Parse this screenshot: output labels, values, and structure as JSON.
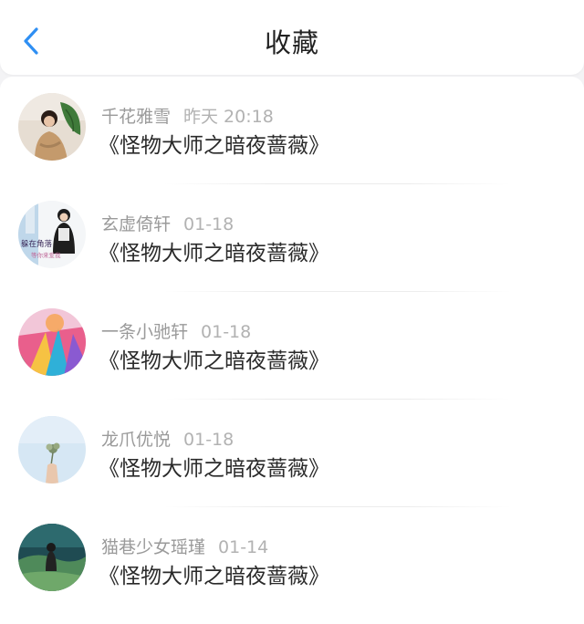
{
  "header": {
    "title": "收藏",
    "back_icon": "chevron-left-icon",
    "accent_color": "#2f8ff3"
  },
  "favorites": [
    {
      "username": "千花雅雪",
      "time": "昨天 20:18",
      "title": "《怪物大师之暗夜蔷薇》",
      "avatar_icon": "avatar-girl-with-leaf"
    },
    {
      "username": "玄虚倚轩",
      "time": "01-18",
      "title": "《怪物大师之暗夜蔷薇》",
      "avatar_icon": "avatar-girl-in-corner",
      "avatar_text_1": "躲在角落",
      "avatar_text_2": "等你来爱我"
    },
    {
      "username": "一条小驰轩",
      "time": "01-18",
      "title": "《怪物大师之暗夜蔷薇》",
      "avatar_icon": "avatar-colorful-balloon"
    },
    {
      "username": "龙爪优悦",
      "time": "01-18",
      "title": "《怪物大师之暗夜蔷薇》",
      "avatar_icon": "avatar-hand-holding-flowers"
    },
    {
      "username": "猫巷少女瑶瑾",
      "time": "01-14",
      "title": "《怪物大师之暗夜蔷薇》",
      "avatar_icon": "avatar-girl-in-landscape"
    }
  ]
}
